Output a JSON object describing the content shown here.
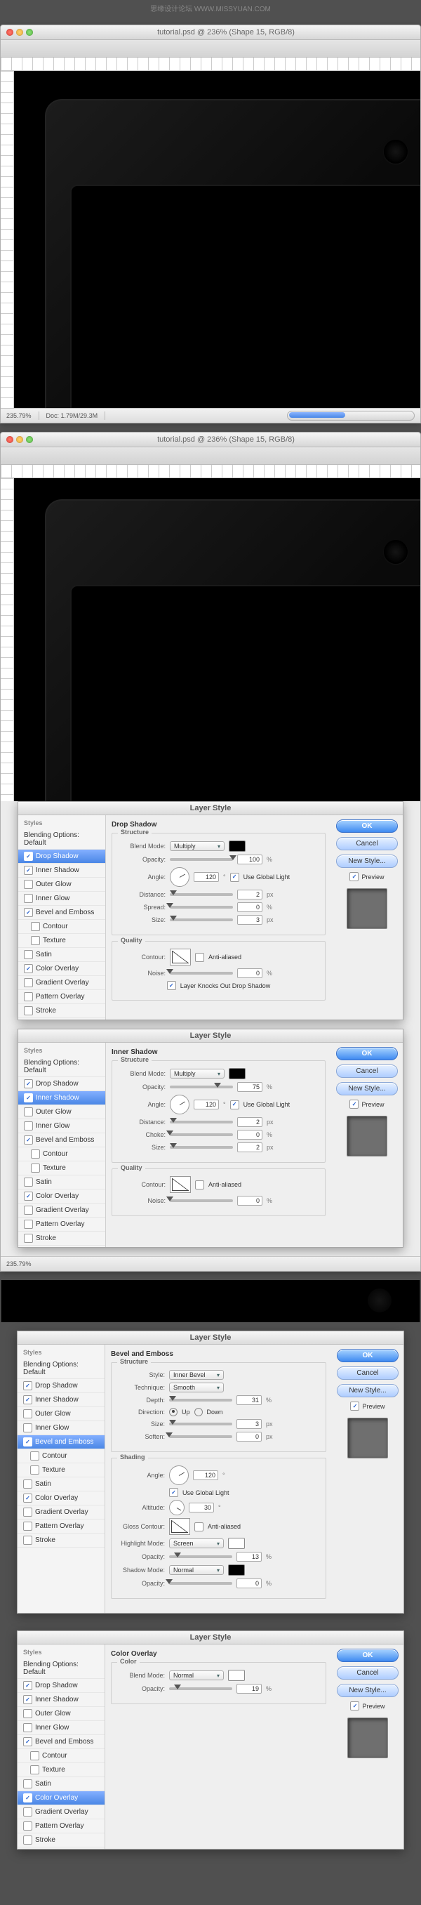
{
  "watermark_top": "思缘设计论坛 WWW.MISSYUAN.COM",
  "window": {
    "title": "tutorial.psd @ 236% (Shape 15, RGB/8)",
    "zoom": "235.79%",
    "doc_info": "Doc: 1.79M/29.3M"
  },
  "dialog_title": "Layer Style",
  "buttons": {
    "ok": "OK",
    "cancel": "Cancel",
    "new_style": "New Style...",
    "preview": "Preview"
  },
  "style_list": {
    "header": "Styles",
    "blending_default": "Blending Options: Default",
    "drop_shadow": "Drop Shadow",
    "inner_shadow": "Inner Shadow",
    "outer_glow": "Outer Glow",
    "inner_glow": "Inner Glow",
    "bevel_emboss": "Bevel and Emboss",
    "contour": "Contour",
    "texture": "Texture",
    "satin": "Satin",
    "color_overlay": "Color Overlay",
    "gradient_overlay": "Gradient Overlay",
    "pattern_overlay": "Pattern Overlay",
    "stroke": "Stroke"
  },
  "panels": {
    "drop_shadow": {
      "title": "Drop Shadow",
      "structure": "Structure",
      "blend_mode": "Blend Mode:",
      "blend_mode_val": "Multiply",
      "opacity": "Opacity:",
      "opacity_val": "100",
      "pct": "%",
      "angle": "Angle:",
      "angle_val": "120",
      "use_global": "Use Global Light",
      "distance": "Distance:",
      "distance_val": "2",
      "px": "px",
      "spread": "Spread:",
      "spread_val": "0",
      "size": "Size:",
      "size_val": "3",
      "quality": "Quality",
      "contour": "Contour:",
      "anti": "Anti-aliased",
      "noise": "Noise:",
      "noise_val": "0",
      "knockout": "Layer Knocks Out Drop Shadow"
    },
    "inner_shadow": {
      "title": "Inner Shadow",
      "structure": "Structure",
      "blend_mode": "Blend Mode:",
      "blend_mode_val": "Multiply",
      "opacity": "Opacity:",
      "opacity_val": "75",
      "pct": "%",
      "angle": "Angle:",
      "angle_val": "120",
      "use_global": "Use Global Light",
      "distance": "Distance:",
      "distance_val": "2",
      "px": "px",
      "choke": "Choke:",
      "choke_val": "0",
      "size": "Size:",
      "size_val": "2",
      "quality": "Quality",
      "contour": "Contour:",
      "anti": "Anti-aliased",
      "noise": "Noise:",
      "noise_val": "0"
    },
    "bevel": {
      "title": "Bevel and Emboss",
      "structure": "Structure",
      "style": "Style:",
      "style_val": "Inner Bevel",
      "technique": "Technique:",
      "technique_val": "Smooth",
      "depth": "Depth:",
      "depth_val": "31",
      "pct": "%",
      "direction": "Direction:",
      "up": "Up",
      "down": "Down",
      "size": "Size:",
      "size_val": "3",
      "px": "px",
      "soften": "Soften:",
      "soften_val": "0",
      "shading": "Shading",
      "angle": "Angle:",
      "angle_val": "120",
      "use_global": "Use Global Light",
      "altitude": "Altitude:",
      "altitude_val": "30",
      "gloss": "Gloss Contour:",
      "anti": "Anti-aliased",
      "highlight_mode": "Highlight Mode:",
      "highlight_val": "Screen",
      "h_opacity": "Opacity:",
      "h_opacity_val": "13",
      "shadow_mode": "Shadow Mode:",
      "shadow_val": "Normal",
      "s_opacity": "Opacity:",
      "s_opacity_val": "0"
    },
    "color_overlay": {
      "title": "Color Overlay",
      "color": "Color",
      "blend_mode": "Blend Mode:",
      "blend_mode_val": "Normal",
      "opacity": "Opacity:",
      "opacity_val": "19",
      "pct": "%"
    }
  }
}
